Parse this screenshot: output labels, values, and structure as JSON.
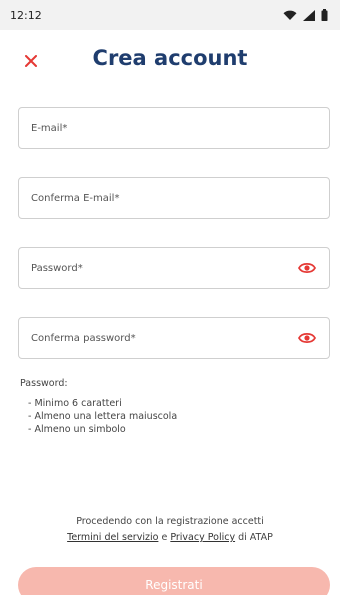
{
  "status_bar": {
    "time": "12:12"
  },
  "header": {
    "title": "Crea account"
  },
  "form": {
    "email_placeholder": "E-mail*",
    "confirm_email_placeholder": "Conferma E-mail*",
    "password_placeholder": "Password*",
    "confirm_password_placeholder": "Conferma password*"
  },
  "password_rules": {
    "title": "Password:",
    "items": [
      "Minimo 6 caratteri",
      "Almeno una lettera maiuscola",
      "Almeno un simbolo"
    ]
  },
  "terms": {
    "line1": "Procedendo con la registrazione accetti",
    "terms_link": "Termini del servizio",
    "conjunction": "e",
    "privacy_link": "Privacy Policy",
    "suffix": "di ATAP"
  },
  "register_button": {
    "label": "Registrati"
  },
  "colors": {
    "accent": "#e53935",
    "title": "#1f3d6e",
    "button_disabled": "#f7b8ae"
  },
  "icons": {
    "close": "close-icon",
    "eye": "eye-icon",
    "wifi": "wifi-icon",
    "signal": "signal-icon",
    "battery": "battery-icon"
  }
}
